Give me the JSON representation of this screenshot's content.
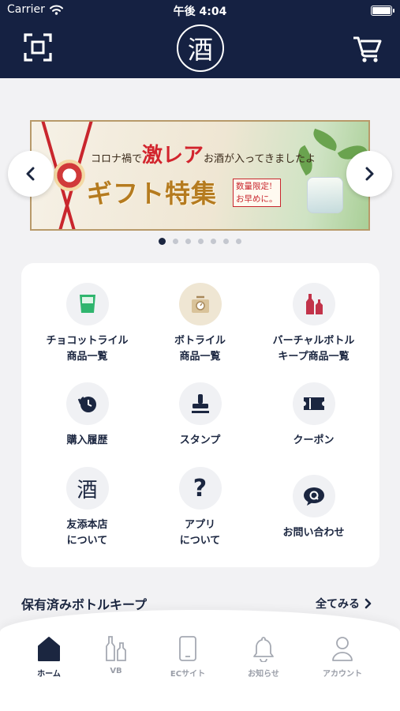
{
  "status_bar": {
    "carrier": "Carrier",
    "time": "午後 4:04"
  },
  "header": {
    "logo_char": "酒"
  },
  "banner": {
    "line1_pre": "コロナ禍で",
    "line1_accent": "激レア",
    "line1_post": "お酒が入ってきましたよ",
    "headline": "ギフト特集",
    "note_line1": "数量限定!",
    "note_line2": "お早めに。",
    "slide_count": 7,
    "active_slide": 1
  },
  "menu": {
    "items": [
      {
        "label": "チョコットライル\n商品一覧",
        "icon": "choco-cup-icon"
      },
      {
        "label": "ボトライル\n商品一覧",
        "icon": "scale-icon"
      },
      {
        "label": "バーチャルボトル\nキープ商品一覧",
        "icon": "bottles-icon"
      },
      {
        "label": "購入履歴",
        "icon": "history-icon"
      },
      {
        "label": "スタンプ",
        "icon": "stamp-icon"
      },
      {
        "label": "クーポン",
        "icon": "coupon-icon"
      },
      {
        "label": "友添本店\nについて",
        "icon": "sake-logo-icon",
        "icon_char": "酒"
      },
      {
        "label": "アプリ\nについて",
        "icon": "question-icon",
        "icon_char": "?"
      },
      {
        "label": "お問い合わせ",
        "icon": "chat-q-icon"
      }
    ]
  },
  "section": {
    "title": "保有済みボトルキープ",
    "see_all": "全てみる"
  },
  "tabbar": {
    "tabs": [
      {
        "label": "ホーム",
        "icon": "home-icon",
        "active": true
      },
      {
        "label": "VB",
        "icon": "bottles-outline-icon",
        "active": false
      },
      {
        "label": "ECサイト",
        "icon": "phone-icon",
        "active": false
      },
      {
        "label": "お知らせ",
        "icon": "bell-icon",
        "active": false
      },
      {
        "label": "アカウント",
        "icon": "user-icon",
        "active": false
      }
    ]
  },
  "colors": {
    "navy": "#152142",
    "accent_red": "#c9262d",
    "accent_green": "#2fb56e",
    "muted": "#9a9ea8"
  }
}
